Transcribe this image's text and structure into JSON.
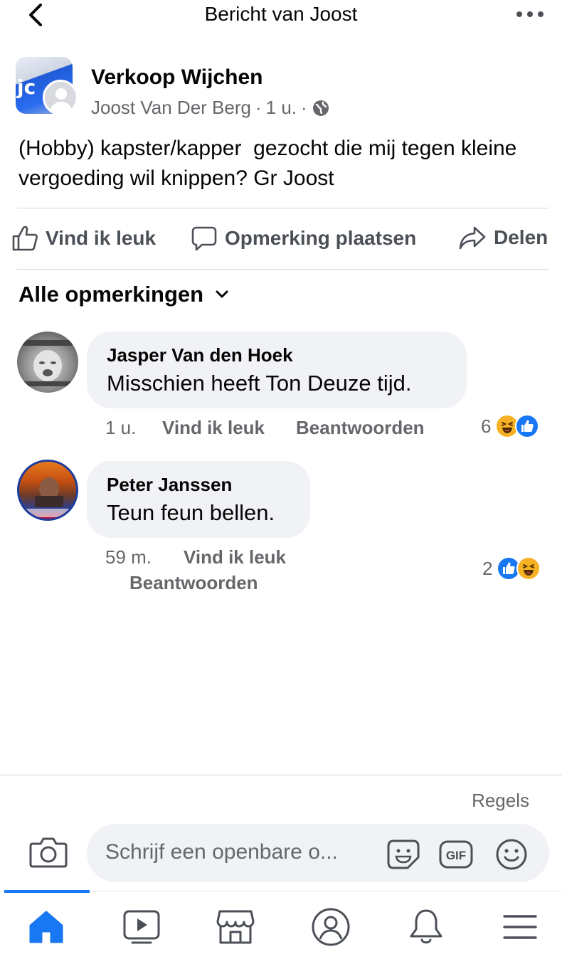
{
  "header": {
    "title": "Bericht van Joost"
  },
  "post": {
    "group_avatar_text": "jc",
    "group_name": "Verkoop Wijchen",
    "author": "Joost Van Der Berg",
    "time": "1 u.",
    "text": "(Hobby) kapster/kapper  gezocht die mij tegen kleine vergoeding wil knippen? Gr Joost"
  },
  "actions": {
    "like": "Vind ik leuk",
    "comment": "Opmerking plaatsen",
    "share": "Delen"
  },
  "comments_sort": {
    "label": "Alle opmerkingen"
  },
  "comments": [
    {
      "name": "Jasper Van den Hoek",
      "text": "Misschien heeft Ton Deuze tijd.",
      "time": "1 u.",
      "like_label": "Vind ik leuk",
      "reply_label": "Beantwoorden",
      "reaction_count": "6",
      "reactions": [
        "haha",
        "like"
      ]
    },
    {
      "name": "Peter Janssen",
      "text": "Teun feun bellen.",
      "time": "59 m.",
      "like_label": "Vind ik leuk",
      "reply_label": "Beantwoorden",
      "reaction_count": "2",
      "reactions": [
        "like",
        "haha"
      ]
    }
  ],
  "composer": {
    "rules_label": "Regels",
    "placeholder": "Schrijf een openbare o...",
    "gif_label": "GIF"
  },
  "tabs": [
    "home-icon",
    "video-icon",
    "marketplace-icon",
    "profile-icon",
    "notifications-icon",
    "menu-icon"
  ],
  "colors": {
    "accent": "#1877f2",
    "secondary_text": "#65676b",
    "bubble_bg": "#f0f2f5"
  }
}
